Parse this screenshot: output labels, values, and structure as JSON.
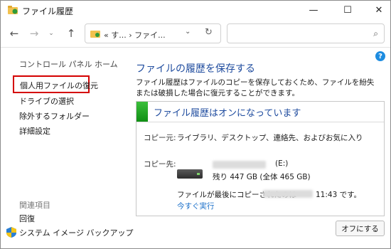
{
  "window": {
    "title": "ファイル履歴",
    "minimize_glyph": "—",
    "maximize_glyph": "☐",
    "close_glyph": "✕"
  },
  "nav": {
    "back_glyph": "←",
    "forward_glyph": "→",
    "recent_glyph": "⌄",
    "up_glyph": "↑",
    "address_crumbs": "« す... › ファイ...",
    "address_dropdown_glyph": "⌄",
    "refresh_glyph": "↻",
    "search_placeholder": "",
    "search_glyph": "⌕"
  },
  "help": {
    "glyph": "?"
  },
  "sidebar": {
    "home": "コントロール パネル ホーム",
    "items": [
      "個人用ファイルの復元",
      "ドライブの選択",
      "除外するフォルダー",
      "詳細設定"
    ],
    "related_heading": "関連項目",
    "related_items": [
      "回復",
      "システム イメージ バックアップ"
    ]
  },
  "main": {
    "title": "ファイルの履歴を保存する",
    "description": "ファイル履歴はファイルのコピーを保存しておくため、ファイルを紛失または破損した場合に復元することができます。",
    "status": "ファイル履歴はオンになっています",
    "copy_source_label": "コピー元:",
    "copy_source_value": "ライブラリ、デスクトップ、連絡先、およびお気に入り",
    "copy_dest_label": "コピー先:",
    "drive_letter": "(E:)",
    "drive_space": "残り 447 GB (全体 465 GB)",
    "last_copied_prefix": "ファイルが最後にコピーされたのは",
    "last_copied_time": "11:43 です。",
    "run_now": "今すぐ実行",
    "off_button": "オフにする"
  },
  "colors": {
    "accent_title": "#1e4b9e",
    "link": "#1a6fc9",
    "highlight_border": "#d40000",
    "status_green": "#1f9d22"
  },
  "icons": [
    "file-history-icon",
    "folder-icon",
    "search-icon",
    "help-icon",
    "shield-icon",
    "drive-icon"
  ]
}
